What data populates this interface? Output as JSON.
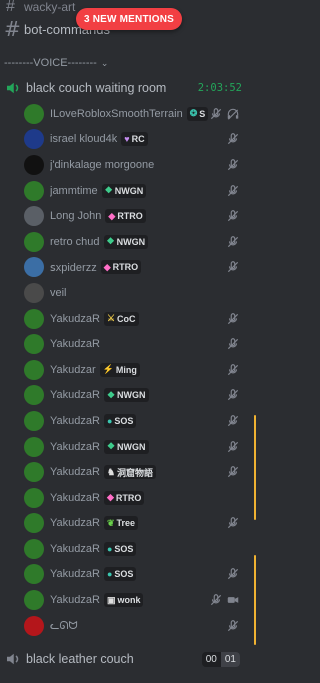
{
  "channels": {
    "top_partial": "wacky-art",
    "bot_commands": "bot-commands"
  },
  "mentions_badge": "3 NEW MENTIONS",
  "category": {
    "label": "--------VOICE--------"
  },
  "voice_channels": [
    {
      "name": "black couch waiting room",
      "timer": "2:03:52"
    },
    {
      "name": "black leather couch",
      "count_current": "00",
      "count_limit": "01"
    }
  ],
  "users": [
    {
      "name": "ILoveRobloxSmoothTerrain",
      "avatar_color": "#2f7a2a",
      "tag": "S",
      "tag_icon": "❂",
      "tag_color": "#3ac7b0",
      "icons": [
        "muted-icon",
        "deafen-icon"
      ]
    },
    {
      "name": "israel kloud4k",
      "avatar_color": "#1e3a8a",
      "tag": "RC",
      "tag_icon": "♥",
      "tag_color": "#c58cf0",
      "icons": [
        "muted-icon"
      ]
    },
    {
      "name": "j'dinkalage morgoone",
      "avatar_color": "#111111",
      "tag": "",
      "tag_icon": "",
      "tag_color": "",
      "icons": [
        "muted-icon"
      ]
    },
    {
      "name": "jammtime",
      "avatar_color": "#2f7a2a",
      "tag": "NWGN",
      "tag_icon": "❖",
      "tag_color": "#3fcf8e",
      "icons": [
        "muted-icon"
      ]
    },
    {
      "name": "Long John",
      "avatar_color": "#5a5f66",
      "tag": "RTRO",
      "tag_icon": "◆",
      "tag_color": "#ff6ec7",
      "icons": [
        "muted-icon"
      ]
    },
    {
      "name": "retro chud",
      "avatar_color": "#2f7a2a",
      "tag": "NWGN",
      "tag_icon": "❖",
      "tag_color": "#3fcf8e",
      "icons": [
        "muted-icon"
      ]
    },
    {
      "name": "ꜱxpiderzz",
      "avatar_color": "#3b6ea5",
      "tag": "RTRO",
      "tag_icon": "◆",
      "tag_color": "#ff6ec7",
      "icons": [
        "muted-icon"
      ]
    },
    {
      "name": "veil",
      "avatar_color": "#4a4a4a",
      "tag": "",
      "tag_icon": "",
      "tag_color": "",
      "icons": []
    },
    {
      "name": "YakudzaR",
      "avatar_color": "#2f7a2a",
      "tag": "CoC",
      "tag_icon": "⚔",
      "tag_color": "#e8c547",
      "icons": [
        "muted-icon"
      ]
    },
    {
      "name": "YakudzaR",
      "avatar_color": "#2f7a2a",
      "tag": "",
      "tag_icon": "",
      "tag_color": "",
      "icons": [
        "muted-icon"
      ]
    },
    {
      "name": "Yakudzar",
      "avatar_color": "#2f7a2a",
      "tag": "Ming",
      "tag_icon": "⚡",
      "tag_color": "#ff4d4d",
      "icons": [
        "muted-icon"
      ]
    },
    {
      "name": "YakudzaR",
      "avatar_color": "#2f7a2a",
      "tag": "NWGN",
      "tag_icon": "❖",
      "tag_color": "#3fcf8e",
      "icons": [
        "muted-icon"
      ]
    },
    {
      "name": "YakudzaR",
      "avatar_color": "#2f7a2a",
      "tag": "SOS",
      "tag_icon": "●",
      "tag_color": "#3ac7b0",
      "icons": [
        "muted-icon"
      ]
    },
    {
      "name": "YakudzaR",
      "avatar_color": "#2f7a2a",
      "tag": "NWGN",
      "tag_icon": "❖",
      "tag_color": "#3fcf8e",
      "icons": [
        "muted-icon"
      ]
    },
    {
      "name": "YakudzaR",
      "avatar_color": "#2f7a2a",
      "tag": "洞窟物語",
      "tag_icon": "♞",
      "tag_color": "#dddddd",
      "icons": [
        "muted-icon"
      ]
    },
    {
      "name": "YakudzaR",
      "avatar_color": "#2f7a2a",
      "tag": "RTRO",
      "tag_icon": "◆",
      "tag_color": "#ff6ec7",
      "icons": []
    },
    {
      "name": "YakudzaR",
      "avatar_color": "#2f7a2a",
      "tag": "Tree",
      "tag_icon": "❦",
      "tag_color": "#6ad14a",
      "icons": [
        "muted-icon"
      ]
    },
    {
      "name": "YakudzaR",
      "avatar_color": "#2f7a2a",
      "tag": "SOS",
      "tag_icon": "●",
      "tag_color": "#3ac7b0",
      "icons": []
    },
    {
      "name": "YakudzaR",
      "avatar_color": "#2f7a2a",
      "tag": "SOS",
      "tag_icon": "●",
      "tag_color": "#3ac7b0",
      "icons": [
        "muted-icon"
      ]
    },
    {
      "name": "YakudzaR",
      "avatar_color": "#2f7a2a",
      "tag": "wonk",
      "tag_icon": "▣",
      "tag_color": "#dddddd",
      "icons": [
        "muted-icon",
        "video-icon"
      ]
    },
    {
      "name": "ᓚᘏᗢ",
      "avatar_color": "#b4161b",
      "tag": "",
      "tag_icon": "",
      "tag_color": "",
      "icons": [
        "muted-icon"
      ]
    }
  ]
}
